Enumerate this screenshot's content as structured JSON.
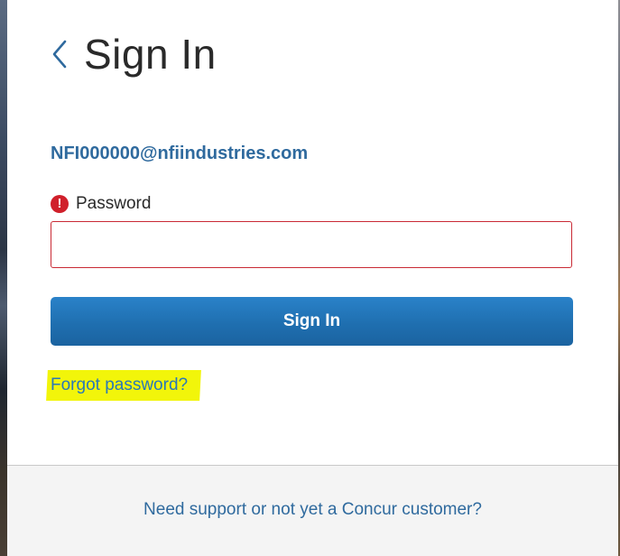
{
  "header": {
    "title": "Sign In",
    "back_icon": "chevron-left-icon"
  },
  "account": {
    "email": "NFI000000@nfiindustries.com"
  },
  "password": {
    "label": "Password",
    "value": "",
    "error_icon": "exclamation-circle-icon",
    "error_icon_glyph": "!",
    "error_color": "#d0202b"
  },
  "actions": {
    "sign_in_label": "Sign In",
    "forgot_password_label": "Forgot password?"
  },
  "footer": {
    "support_label": "Need support or not yet a Concur customer?"
  },
  "colors": {
    "accent": "#1f6fb0",
    "link": "#2f6a9e",
    "highlight": "#f2f50a"
  }
}
